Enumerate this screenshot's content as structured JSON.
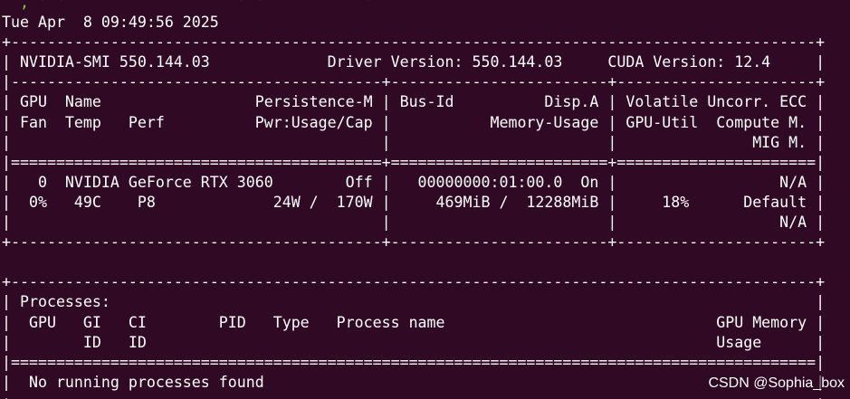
{
  "terminal": {
    "prompt_fragment": "  , ' '  `  ` ` `         ' '           '",
    "lines": [
      "Tue Apr  8 09:49:56 2025",
      "+-----------------------------------------------------------------------------------------+",
      "| NVIDIA-SMI 550.144.03             Driver Version: 550.144.03     CUDA Version: 12.4     |",
      "|-----------------------------------------+------------------------+----------------------+",
      "| GPU  Name                 Persistence-M | Bus-Id          Disp.A | Volatile Uncorr. ECC |",
      "| Fan  Temp   Perf          Pwr:Usage/Cap |           Memory-Usage | GPU-Util  Compute M. |",
      "|                                         |                        |               MIG M. |",
      "|=========================================+========================+======================|",
      "|   0  NVIDIA GeForce RTX 3060        Off |   00000000:01:00.0  On |                  N/A |",
      "|  0%   49C    P8             24W /  170W |     469MiB /  12288MiB |     18%      Default |",
      "|                                         |                        |                  N/A |",
      "+-----------------------------------------+------------------------+----------------------+",
      "",
      "+-----------------------------------------------------------------------------------------+",
      "| Processes:                                                                              |",
      "|  GPU   GI   CI        PID   Type   Process name                              GPU Memory |",
      "|        ID   ID                                                               Usage      |",
      "|=========================================================================================|",
      "|  No running processes found                                                             |",
      "+-----------------------------------------------------------------------------------------+"
    ]
  },
  "watermark": "CSDN @Sophia_box",
  "colors": {
    "background": "#300a24",
    "text": "#ffffff",
    "prompt": "#7fcf3a"
  }
}
